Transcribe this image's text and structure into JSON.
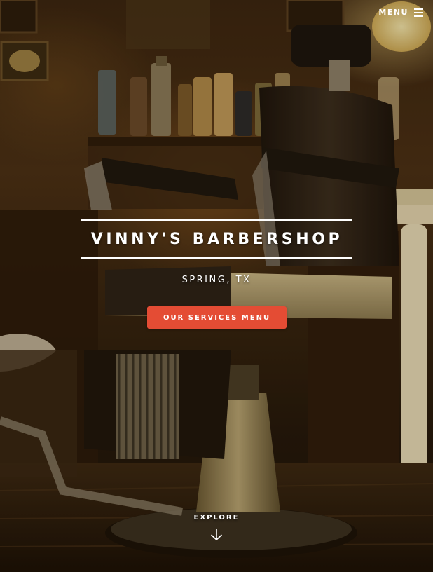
{
  "nav": {
    "menu_label": "MENU",
    "menu_icon": "hamburger-icon"
  },
  "hero": {
    "title": "VINNY'S BARBERSHOP",
    "subtitle": "SPRING, TX",
    "cta_label": "OUR SERVICES MENU",
    "explore_label": "EXPLORE",
    "explore_icon": "arrow-down-icon"
  },
  "colors": {
    "accent": "#e44c34",
    "text": "#ffffff"
  }
}
